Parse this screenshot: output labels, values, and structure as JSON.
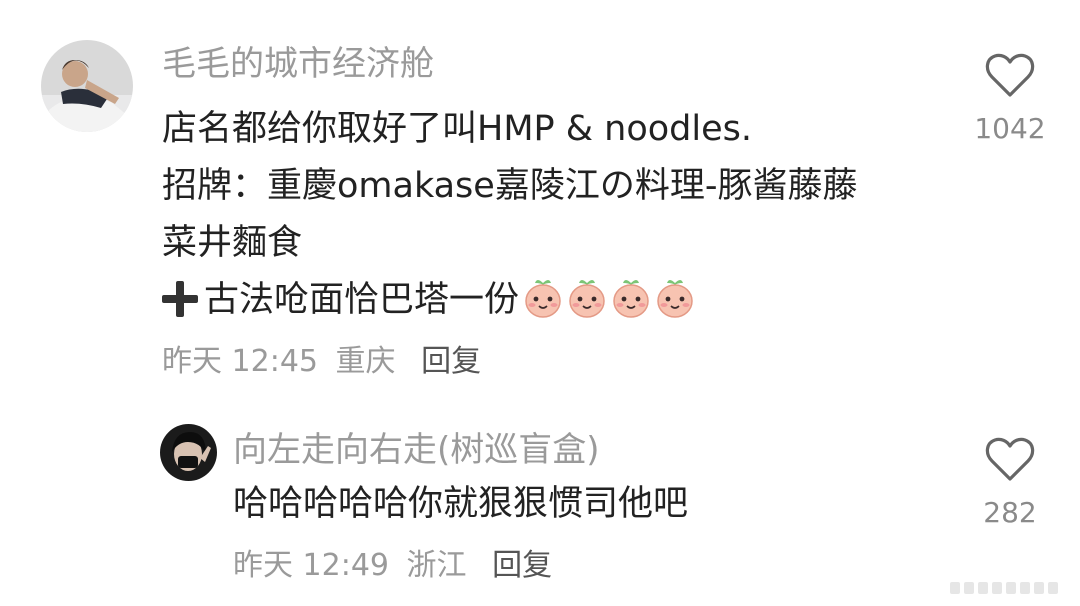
{
  "comments": [
    {
      "username": "毛毛的城市经济舱",
      "lines": [
        "店名都给你取好了叫HMP & noodles.",
        "招牌：重慶omakase嘉陵江の料理-豚酱藤藤",
        "菜井麵食",
        "古法呛面恰巴塔一份"
      ],
      "time": "昨天 12:45",
      "location": "重庆",
      "reply_label": "回复",
      "like_count": "1042",
      "icons": {
        "plus": "heavy-plus-icon",
        "emoji": "peach-face-emoji",
        "like": "heart-outline-icon"
      }
    },
    {
      "username": "向左走向右走(树巡盲盒)",
      "lines": [
        "哈哈哈哈哈你就狠狠惯司他吧"
      ],
      "time": "昨天 12:49",
      "location": "浙江",
      "reply_label": "回复",
      "like_count": "282",
      "icons": {
        "like": "heart-outline-icon"
      }
    }
  ],
  "colors": {
    "username": "#9a9a9a",
    "text": "#222222",
    "meta": "#9a9a9a",
    "reply": "#555555"
  }
}
